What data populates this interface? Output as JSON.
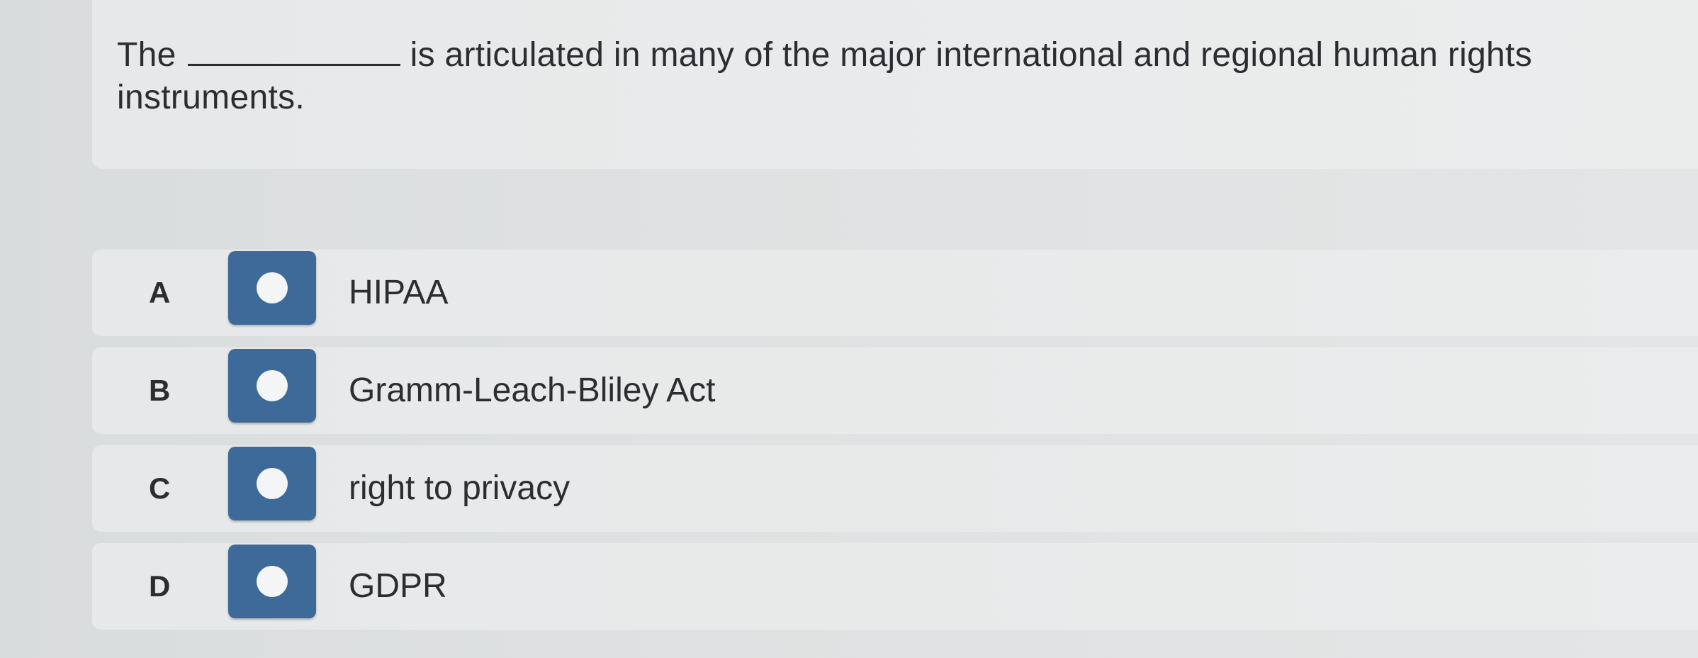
{
  "question": {
    "text_before": "The",
    "text_after": "is articulated in many of the major international and regional human rights instruments."
  },
  "options": [
    {
      "letter": "A",
      "label": "HIPAA"
    },
    {
      "letter": "B",
      "label": "Gramm-Leach-Bliley Act"
    },
    {
      "letter": "C",
      "label": "right to privacy"
    },
    {
      "letter": "D",
      "label": "GDPR"
    }
  ],
  "colors": {
    "radio_box": "#3d6a98",
    "radio_dot": "#f4f5f6",
    "text": "#2b2d31"
  }
}
